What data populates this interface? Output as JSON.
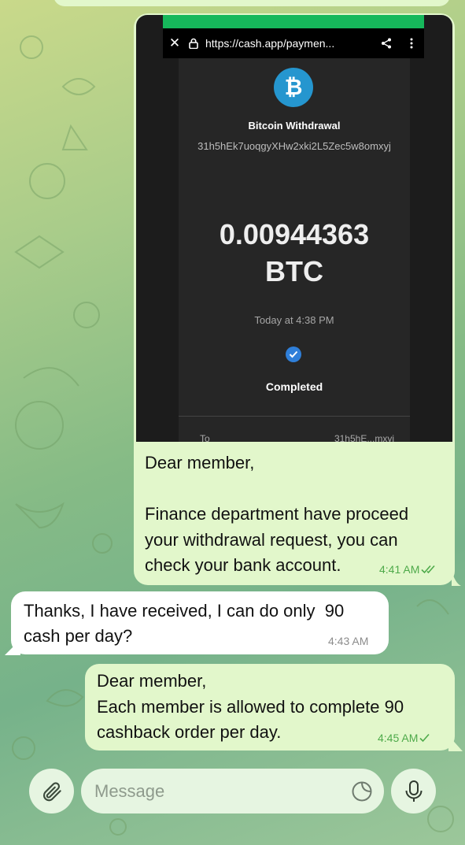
{
  "browser": {
    "url": "https://cash.app/paymen..."
  },
  "receipt": {
    "coin_symbol": "₿",
    "title": "Bitcoin Withdrawal",
    "address": "31h5hEk7uoqgyXHw2xki2L5Zec5w8omxyj",
    "amount": "0.00944363",
    "unit": "BTC",
    "time": "Today at 4:38 PM",
    "status": "Completed",
    "to_label": "To",
    "to_value": "31h5hE...mxyj"
  },
  "messages": {
    "outgoing_1": {
      "lines": [
        "Dear member,",
        "Finance department have proceed",
        "your withdrawal request, you can",
        "check your bank account."
      ],
      "time": "4:41 AM"
    },
    "incoming_1": {
      "lines": [
        "Thanks, I have received, I can do only  90",
        "cash per day?"
      ],
      "time": "4:43 AM"
    },
    "outgoing_2": {
      "lines": [
        "Dear member,",
        "Each member is allowed to complete 90",
        "cashback order per day."
      ],
      "time": "4:45 AM"
    }
  },
  "composer": {
    "placeholder": "Message"
  },
  "colors": {
    "outgoing_bubble": "#e2f7cb",
    "incoming_bubble": "#ffffff",
    "timestamp_green": "#4eaa4a",
    "cashapp_green": "#16b85b",
    "bitcoin_blue": "#2596cf"
  }
}
